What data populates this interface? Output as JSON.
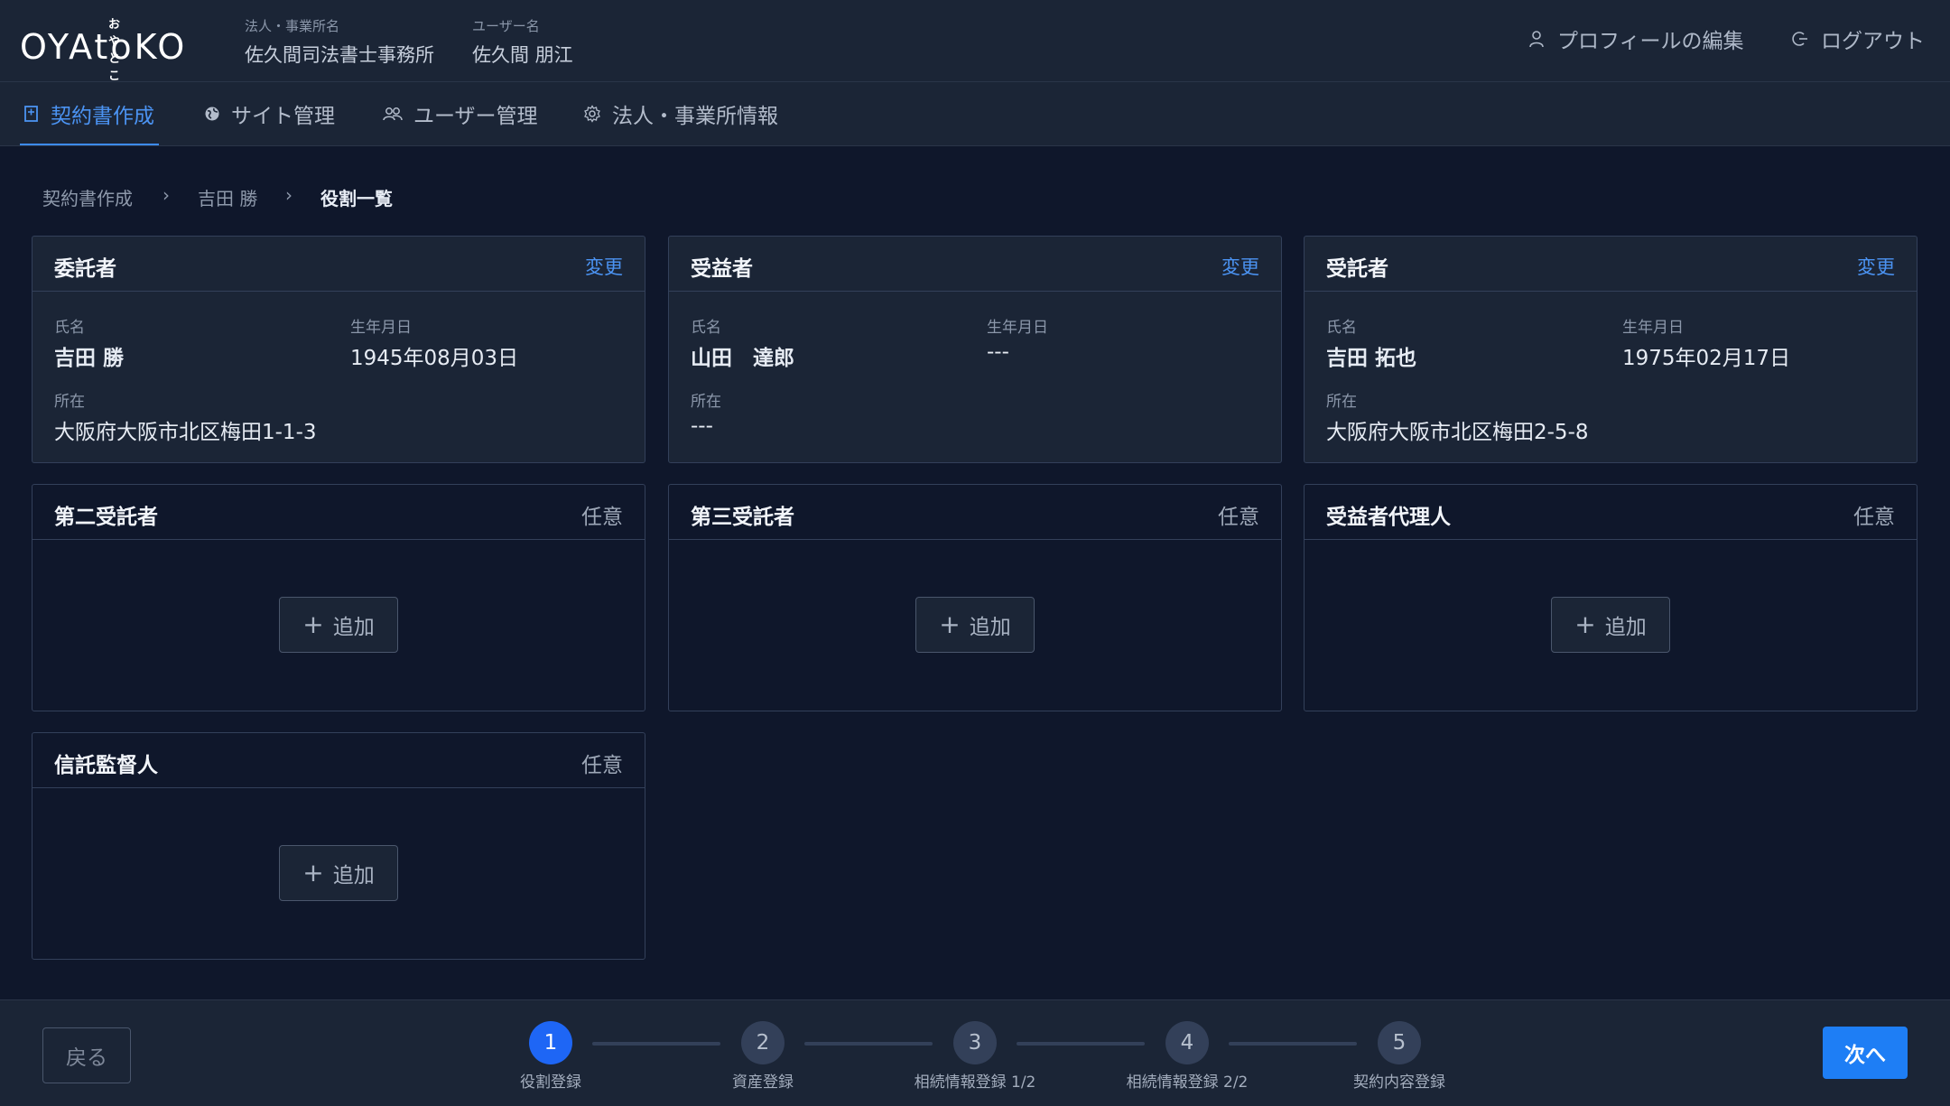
{
  "header": {
    "logo_kana": "おやとこ",
    "logo_text": "OYAtoKO",
    "company_label": "法人・事業所名",
    "company_name": "佐久間司法書士事務所",
    "user_label": "ユーザー名",
    "user_name": "佐久間 朋江",
    "profile_edit": "プロフィールの編集",
    "logout": "ログアウト"
  },
  "nav": {
    "items": [
      {
        "label": "契約書作成",
        "icon": "document-icon",
        "active": true
      },
      {
        "label": "サイト管理",
        "icon": "globe-icon",
        "active": false
      },
      {
        "label": "ユーザー管理",
        "icon": "users-icon",
        "active": false
      },
      {
        "label": "法人・事業所情報",
        "icon": "gear-icon",
        "active": false
      }
    ]
  },
  "breadcrumb": [
    "契約書作成",
    "吉田 勝",
    "役割一覧"
  ],
  "breadcrumb_sep": "›",
  "labels": {
    "name": "氏名",
    "birth": "生年月日",
    "address": "所在",
    "change": "変更",
    "optional": "任意",
    "add": "追加"
  },
  "cards": {
    "settlor": {
      "title": "委託者",
      "name": "吉田 勝",
      "birth": "1945年08月03日",
      "address": "大阪府大阪市北区梅田1-1-3"
    },
    "beneficiary": {
      "title": "受益者",
      "name": "山田　達郎",
      "birth": "---",
      "address": "---"
    },
    "trustee": {
      "title": "受託者",
      "name": "吉田 拓也",
      "birth": "1975年02月17日",
      "address": "大阪府大阪市北区梅田2-5-8"
    },
    "second_trustee": {
      "title": "第二受託者"
    },
    "third_trustee": {
      "title": "第三受託者"
    },
    "beneficiary_agent": {
      "title": "受益者代理人"
    },
    "trust_supervisor": {
      "title": "信託監督人"
    }
  },
  "footer": {
    "back": "戻る",
    "next": "次へ",
    "current_step": 1,
    "steps": [
      {
        "num": "1",
        "label": "役割登録"
      },
      {
        "num": "2",
        "label": "資産登録"
      },
      {
        "num": "3",
        "label": "相続情報登録 1/2"
      },
      {
        "num": "4",
        "label": "相続情報登録 2/2"
      },
      {
        "num": "5",
        "label": "契約内容登録"
      }
    ]
  },
  "colors": {
    "accent": "#3d8bf2",
    "primary_button": "#1e7ef5",
    "background": "#0f172b",
    "panel": "#1b2536"
  }
}
